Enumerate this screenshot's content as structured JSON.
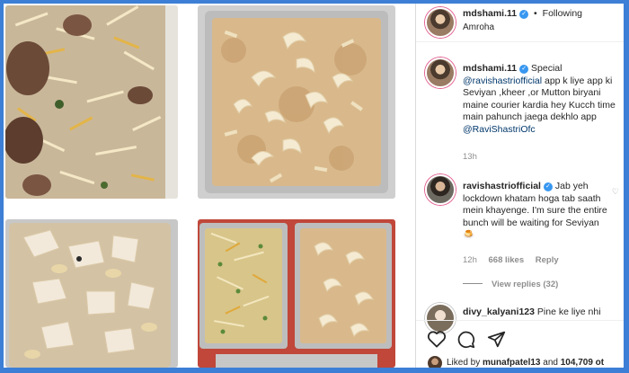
{
  "header": {
    "username": "mdshami.11",
    "separator": "•",
    "follow_status": "Following",
    "location": "Amroha"
  },
  "caption": {
    "username": "mdshami.11",
    "intro": " Special",
    "mention1": "@ravishastriofficial",
    "text": " app k liye app ki Seviyan ,kheer ,or Mutton biryani maine courier kardia hey Kucch time main pahunch jaega dekhlo app ",
    "mention2": "@RaviShastriOfc",
    "time": "13h"
  },
  "comment": {
    "username": "ravishastriofficial",
    "text": " Jab yeh lockdown khatam hoga tab saath mein khayenge. I'm sure the entire bunch will be waiting for Seviyan 🍮",
    "time": "12h",
    "likes": "668 likes",
    "reply": "Reply",
    "view_replies": "View replies (32)"
  },
  "comment2": {
    "username": "divy_kalyani123",
    "text": " Pine ke liye nhi"
  },
  "likes": {
    "prefix": "Liked by ",
    "user": "munafpatel13",
    "middle": " and ",
    "count": "104,709 ot"
  },
  "icons": {
    "verified": "verified-badge-icon",
    "like": "heart-icon",
    "comment": "comment-icon",
    "share": "share-icon"
  },
  "colors": {
    "background_frame": "#3d7fd6",
    "verified": "#3897f0",
    "mention": "#00376b"
  }
}
